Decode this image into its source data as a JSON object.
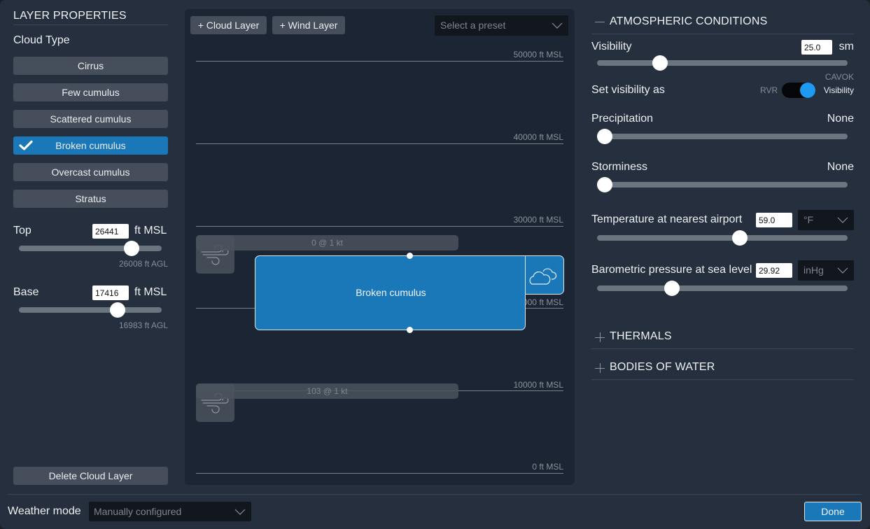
{
  "layer_properties": {
    "title": "LAYER PROPERTIES",
    "cloud_type_label": "Cloud Type",
    "cloud_types": [
      {
        "label": "Cirrus",
        "selected": false
      },
      {
        "label": "Few cumulus",
        "selected": false
      },
      {
        "label": "Scattered cumulus",
        "selected": false
      },
      {
        "label": "Broken cumulus",
        "selected": true
      },
      {
        "label": "Overcast cumulus",
        "selected": false
      },
      {
        "label": "Stratus",
        "selected": false
      }
    ],
    "top": {
      "label": "Top",
      "value": "26441",
      "unit": "ft MSL",
      "agl": "26008 ft AGL",
      "slider_fraction": 0.79
    },
    "base": {
      "label": "Base",
      "value": "17416",
      "unit": "ft MSL",
      "agl": "16983 ft AGL",
      "slider_fraction": 0.69
    },
    "delete_label": "Delete Cloud Layer"
  },
  "layers_view": {
    "add_cloud_label": "+ Cloud Layer",
    "add_wind_label": "+ Wind Layer",
    "preset_placeholder": "Select a preset",
    "altitude_lines": [
      {
        "label": "50000 ft MSL",
        "ft": 50000
      },
      {
        "label": "40000 ft MSL",
        "ft": 40000
      },
      {
        "label": "30000 ft MSL",
        "ft": 30000
      },
      {
        "label": "20000 ft MSL",
        "ft": 20000
      },
      {
        "label": "10000 ft MSL",
        "ft": 10000
      },
      {
        "label": "0 ft MSL",
        "ft": 0
      }
    ],
    "wind_layers": [
      {
        "label": "0 @ 1 kt",
        "icon": "wind-icon"
      },
      {
        "label": "103 @ 1 kt",
        "icon": "wind-icon"
      }
    ],
    "cloud_layer": {
      "label": "Broken cumulus",
      "icon": "cloud-icon"
    }
  },
  "atmospheric": {
    "title": "ATMOSPHERIC CONDITIONS",
    "visibility": {
      "label": "Visibility",
      "value": "25.0",
      "unit": "sm",
      "max_label": "CAVOK",
      "slider_fraction": 0.25
    },
    "visibility_mode": {
      "label": "Set visibility as",
      "off_label": "RVR",
      "on_label": "Visibility",
      "on": true
    },
    "precipitation": {
      "label": "Precipitation",
      "value": "None",
      "slider_fraction": 0.0
    },
    "storminess": {
      "label": "Storminess",
      "value": "None",
      "slider_fraction": 0.0
    },
    "temperature": {
      "label": "Temperature at nearest airport",
      "value": "59.0",
      "unit": "°F",
      "slider_fraction": 0.57
    },
    "pressure": {
      "label": "Barometric pressure at sea level",
      "value": "29.92",
      "unit": "inHg",
      "slider_fraction": 0.3
    }
  },
  "sections": [
    {
      "label": "THERMALS",
      "expanded": false
    },
    {
      "label": "BODIES OF WATER",
      "expanded": false
    }
  ],
  "footer": {
    "weather_mode_label": "Weather mode",
    "weather_mode_value": "Manually configured",
    "done_label": "Done"
  },
  "colors": {
    "accent": "#1a78b8",
    "toggle_on": "#1e9bf0",
    "panel": "#252f3e",
    "canvas": "#1c2533"
  }
}
